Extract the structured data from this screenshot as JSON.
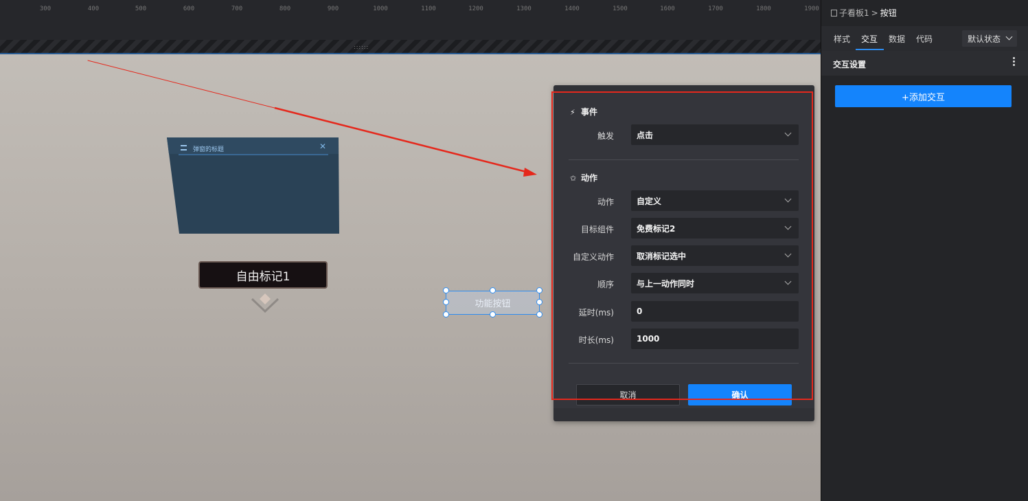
{
  "ruler": {
    "ticks": [
      "300",
      "400",
      "500",
      "600",
      "700",
      "800",
      "900",
      "1000",
      "1100",
      "1200",
      "1300",
      "1400",
      "1500",
      "1600",
      "1700",
      "1800",
      "1900"
    ],
    "handle_glyph": "::::::"
  },
  "canvas": {
    "panel_widget": {
      "title": "弹窗的标题",
      "close_glyph": "✕",
      "icon": "list-icon"
    },
    "marker": {
      "label": "自由标记1",
      "icon": "chevron-down-icon"
    },
    "function_button": {
      "label": "功能按钮"
    }
  },
  "dialog": {
    "event_section": {
      "title": "事件",
      "icon": "bolt-icon",
      "icon_glyph": "⚡"
    },
    "trigger": {
      "label": "触发",
      "value": "点击"
    },
    "action_section": {
      "title": "动作",
      "icon": "star-icon",
      "icon_glyph": "✩"
    },
    "fields": {
      "action": {
        "label": "动作",
        "value": "自定义"
      },
      "target": {
        "label": "目标组件",
        "value": "免费标记2"
      },
      "custom_action": {
        "label": "自定义动作",
        "value": "取消标记选中"
      },
      "order": {
        "label": "顺序",
        "value": "与上一动作同时"
      },
      "delay": {
        "label": "延时(ms)",
        "value": "0"
      },
      "duration": {
        "label": "时长(ms)",
        "value": "1000"
      }
    },
    "cancel_label": "取消",
    "confirm_label": "确认"
  },
  "right_panel": {
    "breadcrumb": {
      "parent": "子看板1",
      "separator": ">",
      "current": "按钮"
    },
    "tabs": [
      "样式",
      "交互",
      "数据",
      "代码"
    ],
    "active_tab": "交互",
    "state_select": "默认状态",
    "section_title": "交互设置",
    "add_button": "+添加交互"
  },
  "colors": {
    "accent": "#1484fc",
    "highlight": "#e5281c",
    "dialog_bg": "#34353b",
    "field_bg": "#26272b"
  }
}
